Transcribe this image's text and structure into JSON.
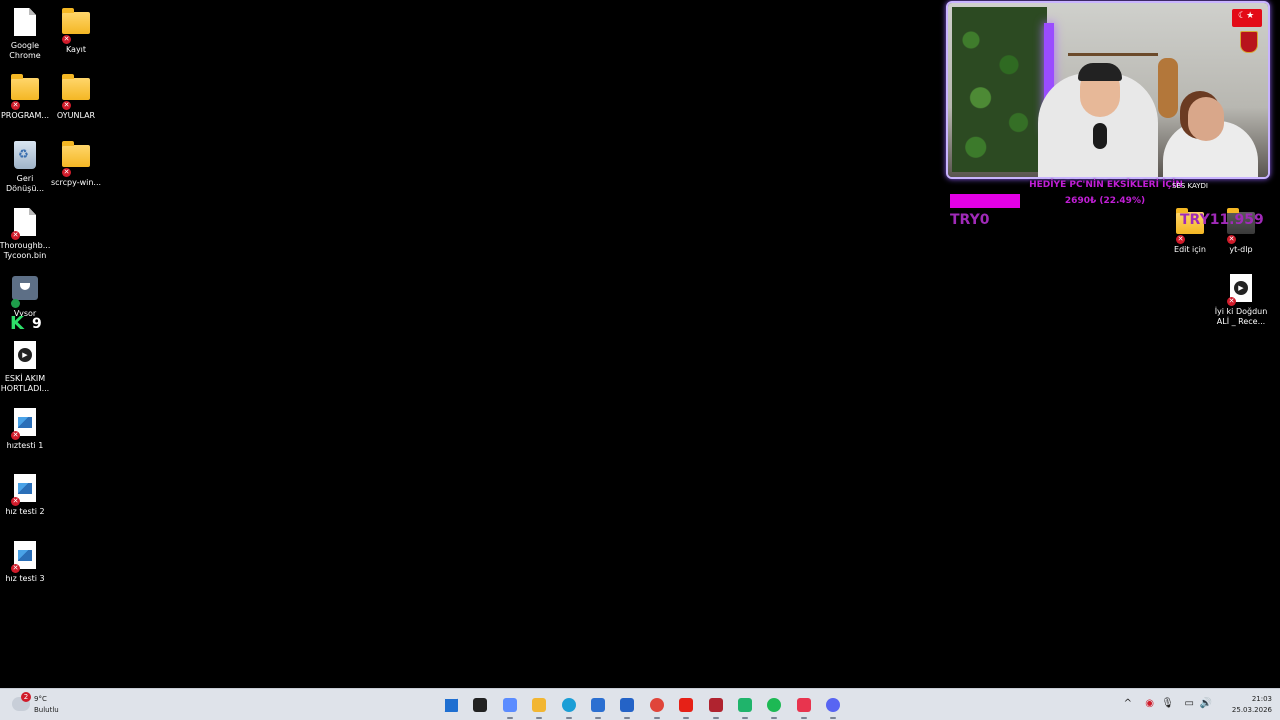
{
  "desktop": {
    "icons_left": [
      {
        "id": "chrome",
        "label": "Google Chrome",
        "type": "doc",
        "badge": "none"
      },
      {
        "id": "kayit",
        "label": "Kayıt",
        "type": "folder",
        "badge": "x"
      },
      {
        "id": "programlar",
        "label": "PROGRAM...",
        "type": "folder",
        "badge": "x"
      },
      {
        "id": "oyunlar",
        "label": "OYUNLAR",
        "type": "folder",
        "badge": "x"
      },
      {
        "id": "geri-donusum",
        "label": "Geri Dönüşü...",
        "type": "bin",
        "badge": "none"
      },
      {
        "id": "scrcpy",
        "label": "scrcpy-win...",
        "type": "folder",
        "badge": "x"
      },
      {
        "id": "thoroughbred",
        "label": "Thoroughb... Tycoon.bin",
        "type": "doc",
        "badge": "x"
      },
      {
        "id": "vysor",
        "label": "Vysor",
        "type": "vysor",
        "badge": "ok"
      },
      {
        "id": "eski-akim",
        "label": "ESKİ AKIM HORTLADI...",
        "type": "video",
        "badge": "none"
      },
      {
        "id": "hiztesti1",
        "label": "hıztesti 1",
        "type": "image",
        "badge": "x"
      },
      {
        "id": "hiztesti2",
        "label": "hız testi 2",
        "type": "image",
        "badge": "x"
      },
      {
        "id": "hiztesti3",
        "label": "hız testi 3",
        "type": "image",
        "badge": "x"
      }
    ],
    "icons_right": [
      {
        "id": "edit-icin",
        "label": "Edit için",
        "type": "folder",
        "badge": "x"
      },
      {
        "id": "yt-dlp",
        "label": "yt-dlp",
        "type": "folder",
        "badge": "x"
      },
      {
        "id": "iyi-ki-dogdun",
        "label": "İyi ki Doğdun ALİ _ Rece...",
        "type": "video",
        "badge": "x"
      }
    ],
    "k9_letter": "K",
    "k9_number": "9",
    "ses_kaydi": "SES KAYDI"
  },
  "stream_overlay": {
    "goal_title": "HEDİYE PC'NİN EKSİKLERİ İÇİN",
    "goal_amount_text": "2690₺ (22.49%)",
    "goal_progress_fraction": 0.2249,
    "goal_current": "TRY0",
    "goal_target": "TRY11.959",
    "flag_color": "#e30a17",
    "goal_color": "#e300e6"
  },
  "taskbar": {
    "weather_temp": "9°C",
    "weather_condition": "Bulutlu",
    "weather_badge": "2",
    "apps": [
      {
        "name": "windows-start-icon",
        "color": "#1f6fd1"
      },
      {
        "name": "task-view-icon",
        "color": "#222222"
      },
      {
        "name": "copilot-icon",
        "color": "#5b8cff"
      },
      {
        "name": "file-explorer-icon",
        "color": "#f2b632"
      },
      {
        "name": "edge-icon",
        "color": "#1b9ed6"
      },
      {
        "name": "store-icon",
        "color": "#2b6fd1"
      },
      {
        "name": "outlook-icon",
        "color": "#2463c7"
      },
      {
        "name": "chrome-icon",
        "color": "#e0453a"
      },
      {
        "name": "youtube-icon",
        "color": "#e62117"
      },
      {
        "name": "video-editor-icon",
        "color": "#b0232f"
      },
      {
        "name": "app-green-icon",
        "color": "#1fb46b"
      },
      {
        "name": "spotify-icon",
        "color": "#1db954"
      },
      {
        "name": "app-red-icon",
        "color": "#e8344e"
      },
      {
        "name": "discord-icon",
        "color": "#5865f2"
      }
    ],
    "clock_time": "21:03",
    "clock_date": "25.03.2026"
  }
}
